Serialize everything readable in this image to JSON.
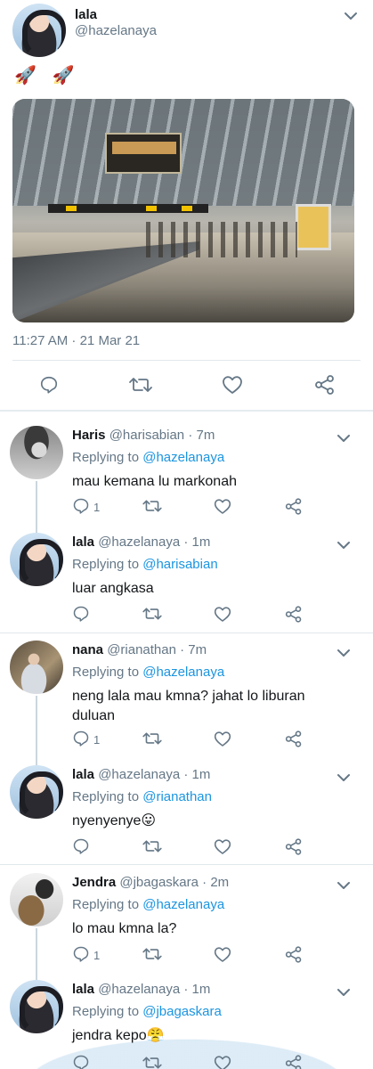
{
  "main": {
    "name": "lala",
    "handle": "@hazelanaya",
    "text": "🚀 🚀",
    "photo_alt": "",
    "timestamp": "11:27 AM · 21 Mar 21"
  },
  "replies": [
    {
      "name": "Haris",
      "handle": "@harisabian",
      "time": "· 7m",
      "replying_label": "Replying to",
      "replying_to": "@hazelanaya",
      "text": "mau kemana lu markonah",
      "reply_count": "1"
    },
    {
      "name": "lala",
      "handle": "@hazelanaya",
      "time": "· 1m",
      "replying_label": "Replying to",
      "replying_to": "@harisabian",
      "text": "luar angkasa",
      "reply_count": ""
    },
    {
      "name": "nana",
      "handle": "@rianathan",
      "time": "· 7m",
      "replying_label": "Replying to",
      "replying_to": "@hazelanaya",
      "text": "neng lala mau kmna? jahat lo liburan duluan",
      "reply_count": "1"
    },
    {
      "name": "lala",
      "handle": "@hazelanaya",
      "time": "· 1m",
      "replying_label": "Replying to",
      "replying_to": "@rianathan",
      "text": "nyenyenye😛",
      "reply_count": ""
    },
    {
      "name": "Jendra",
      "handle": "@jbagaskara",
      "time": "· 2m",
      "replying_label": "Replying to",
      "replying_to": "@hazelanaya",
      "text": "lo mau kmna la?",
      "reply_count": "1"
    },
    {
      "name": "lala",
      "handle": "@hazelanaya",
      "time": "· 1m",
      "replying_label": "Replying to",
      "replying_to": "@jbagaskara",
      "text": "jendra kepo😤",
      "reply_count": ""
    }
  ],
  "colors": {
    "link": "#1b95e0",
    "secondary": "#657786",
    "icon": "#657786",
    "divider": "#e1e8ed"
  },
  "icons": [
    "reply-icon",
    "retweet-icon",
    "like-icon",
    "share-icon",
    "chevron-down-icon"
  ]
}
